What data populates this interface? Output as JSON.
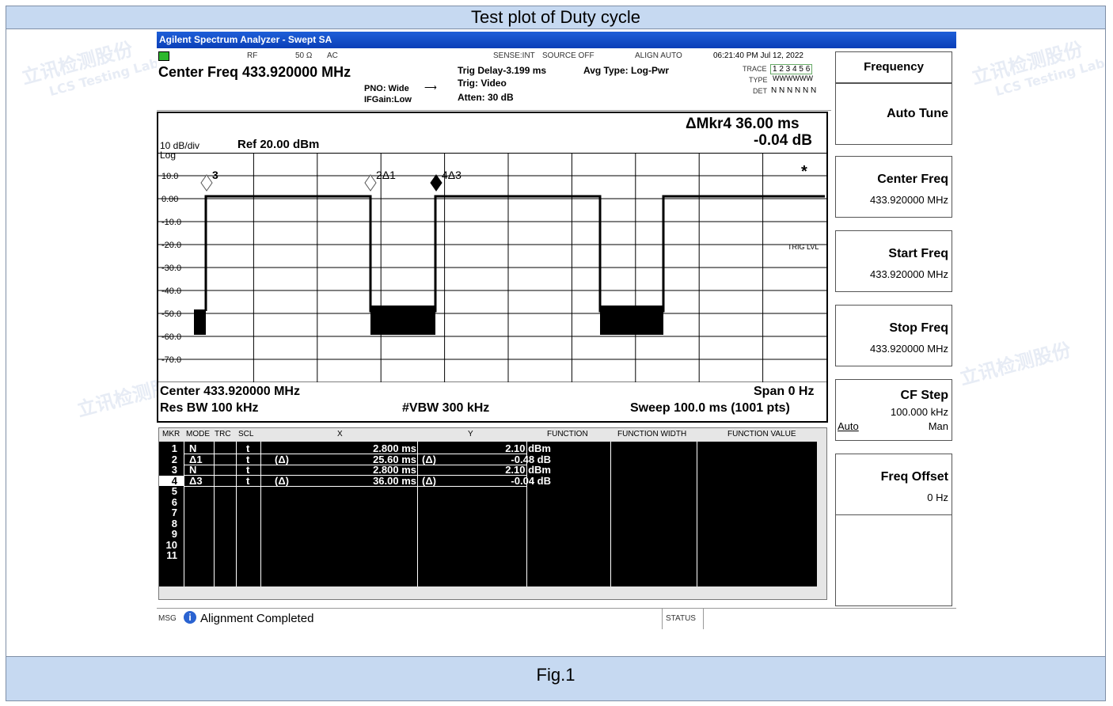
{
  "page": {
    "top_title": "Test plot of Duty cycle",
    "caption": "Fig.1"
  },
  "watermarks": [
    "立讯检测股份",
    "LCS Testing Lab"
  ],
  "app": {
    "title": "Agilent Spectrum Analyzer - Swept SA"
  },
  "topbar": {
    "rf": "RF",
    "ohm": "50 Ω",
    "ac": "AC",
    "sense": "SENSE:INT",
    "source": "SOURCE OFF",
    "align": "ALIGN AUTO",
    "datetime": "06:21:40 PM Jul 12, 2022",
    "center_freq": "Center Freq 433.920000 MHz",
    "pno": "PNO: Wide",
    "ifgain": "IFGain:Low",
    "trig_delay": "Trig Delay-3.199 ms",
    "trig": "Trig: Video",
    "atten": "Atten: 30 dB",
    "avg_type": "Avg Type: Log-Pwr",
    "trace_label": "TRACE",
    "trace_nums": "1 2 3 4 5 6",
    "type_label": "TYPE",
    "type_val": "WWWWWW",
    "det_label": "DET",
    "det_val": "N N N N N N"
  },
  "graph": {
    "scale": "10 dB/div",
    "log": "Log",
    "ref": "Ref 20.00 dBm",
    "mkr_readout": "ΔMkr4 36.00 ms",
    "mkr_value": "-0.04 dB",
    "ylabels": [
      "10.0",
      "0.00",
      "-10.0",
      "-20.0",
      "-30.0",
      "-40.0",
      "-50.0",
      "-60.0",
      "-70.0"
    ],
    "trig_lvl": "TRIG LVL",
    "markers": [
      "3",
      "2Δ1",
      "4Δ3",
      "*"
    ],
    "center": "Center 433.920000 MHz",
    "span": "Span 0 Hz",
    "rbw": "Res BW 100 kHz",
    "vbw": "#VBW 300 kHz",
    "sweep": "Sweep  100.0 ms (1001 pts)"
  },
  "table": {
    "headers": [
      "MKR",
      "MODE",
      "TRC",
      "SCL",
      "X",
      "Y",
      "FUNCTION",
      "FUNCTION WIDTH",
      "FUNCTION VALUE"
    ],
    "rows": [
      {
        "n": "1",
        "mode": "N",
        "scl": "t",
        "xd": "",
        "x": "2.800 ms",
        "yd": "",
        "y": "2.10 dBm"
      },
      {
        "n": "2",
        "mode": "Δ1",
        "scl": "t",
        "xd": "(Δ)",
        "x": "25.60 ms",
        "yd": "(Δ)",
        "y": "-0.48 dB"
      },
      {
        "n": "3",
        "mode": "N",
        "scl": "t",
        "xd": "",
        "x": "2.800 ms",
        "yd": "",
        "y": "2.10 dBm"
      },
      {
        "n": "4",
        "mode": "Δ3",
        "scl": "t",
        "xd": "(Δ)",
        "x": "36.00 ms",
        "yd": "(Δ)",
        "y": "-0.04 dB"
      },
      {
        "n": "5"
      },
      {
        "n": "6"
      },
      {
        "n": "7"
      },
      {
        "n": "8"
      },
      {
        "n": "9"
      },
      {
        "n": "10"
      },
      {
        "n": "11"
      }
    ]
  },
  "softkeys": {
    "menu": "Frequency",
    "auto_tune": "Auto Tune",
    "center": {
      "label": "Center Freq",
      "value": "433.920000 MHz"
    },
    "start": {
      "label": "Start Freq",
      "value": "433.920000 MHz"
    },
    "stop": {
      "label": "Stop Freq",
      "value": "433.920000 MHz"
    },
    "cfstep": {
      "label": "CF Step",
      "value": "100.000 kHz",
      "auto": "Auto",
      "man": "Man"
    },
    "offset": {
      "label": "Freq Offset",
      "value": "0 Hz"
    }
  },
  "status": {
    "msg_label": "MSG",
    "message": "Alignment Completed",
    "status_label": "STATUS"
  }
}
